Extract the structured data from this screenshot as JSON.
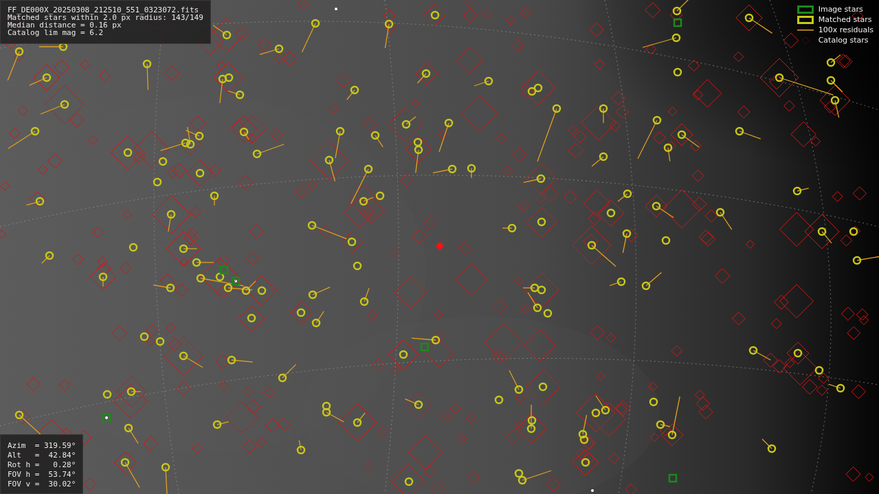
{
  "image_info": {
    "lines": [
      "FF_DE000X_20250308_212510_551_0323072.fits",
      "Matched stars within 2.0 px radius: 143/149",
      "Median distance = 0.16 px",
      "Catalog lim mag = 6.2"
    ]
  },
  "legend": [
    {
      "label": "Image stars",
      "kind": "image"
    },
    {
      "label": "Matched stars",
      "kind": "matched"
    },
    {
      "label": "100x residuals",
      "kind": "residual"
    },
    {
      "label": "Catalog stars",
      "kind": "catalog"
    }
  ],
  "pointing": {
    "lines": [
      "Azim  = 319.59°",
      "Alt   =  42.84°",
      "Rot h =   0.28°",
      "FOV h =  53.74°",
      "FOV v =  30.02°"
    ]
  }
}
